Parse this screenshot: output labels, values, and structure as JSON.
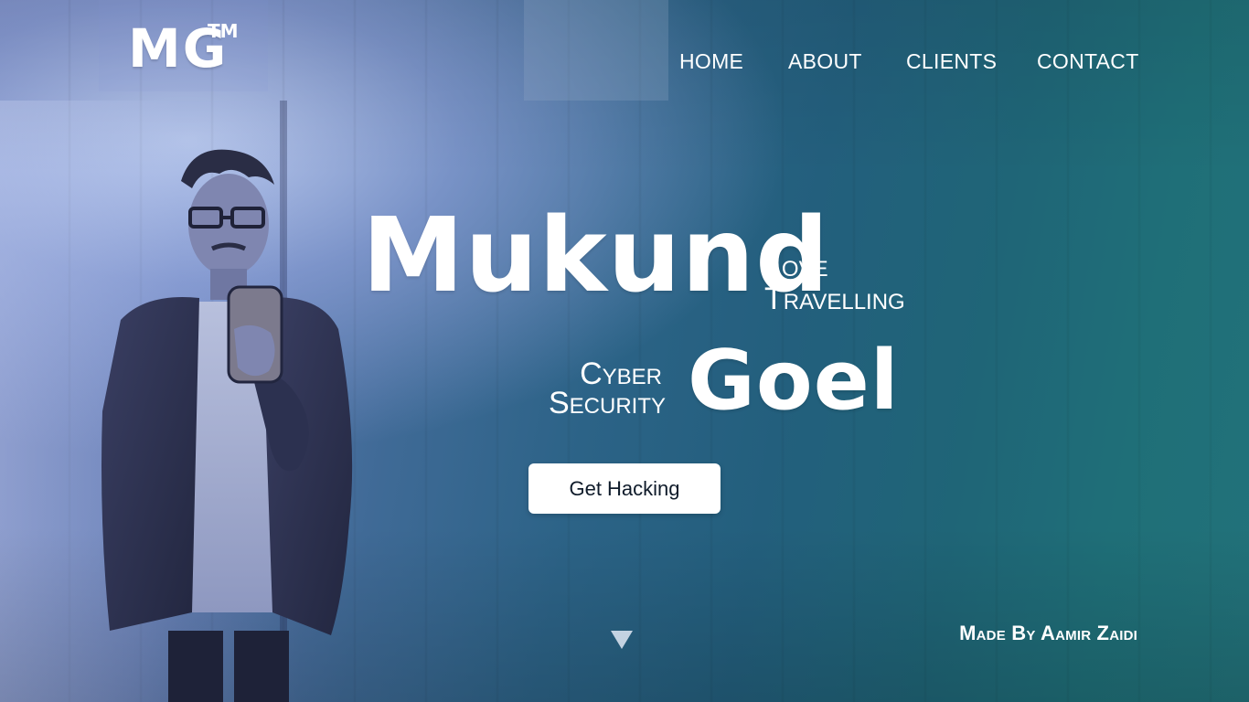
{
  "brand": {
    "logo_text": "MG",
    "trademark": "TM"
  },
  "nav": {
    "items": [
      {
        "label": "HOME"
      },
      {
        "label": "ABOUT"
      },
      {
        "label": "CLIENTS"
      },
      {
        "label": "CONTACT"
      }
    ]
  },
  "hero": {
    "first_name": "Mukund",
    "last_name": "Goel",
    "tagline_right_line1": "Love",
    "tagline_right_line2": "Travelling",
    "tagline_left_line1": "Cyber",
    "tagline_left_line2": "Security",
    "cta_label": "Get Hacking"
  },
  "footer": {
    "credit": "Made By Aamir Zaidi"
  },
  "icons": {
    "scroll_down": "triangle-down-icon"
  },
  "colors": {
    "accent_teal": "#1f6f78",
    "accent_blue": "#5f78b0",
    "text": "#ffffff",
    "button_text": "#0f1b2a",
    "button_bg": "#ffffff"
  }
}
